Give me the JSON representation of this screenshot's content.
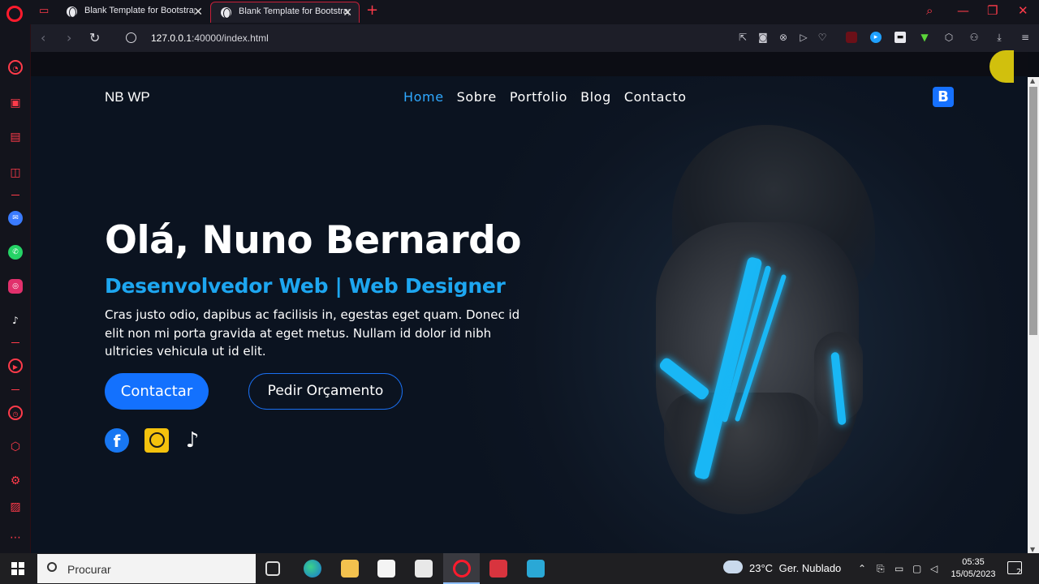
{
  "browser": {
    "tabs": [
      {
        "title": "Blank Template for Bootstrap",
        "active": false
      },
      {
        "title": "Blank Template for Bootstrap",
        "active": true
      }
    ],
    "url_host": "127.0.0.1",
    "url_rest": ":40000/index.html",
    "accent_color": "#ff1b2d"
  },
  "site": {
    "brand": "NB WP",
    "nav": [
      {
        "label": "Home",
        "current": true
      },
      {
        "label": "Sobre"
      },
      {
        "label": "Portfolio"
      },
      {
        "label": "Blog"
      },
      {
        "label": "Contacto"
      }
    ],
    "badge": "B",
    "hero": {
      "title": "Olá, Nuno Bernardo",
      "subtitle": "Desenvolvedor Web | Web Designer",
      "description": "Cras justo odio, dapibus ac facilisis in, egestas eget quam. Donec id elit non mi porta gravida at eget metus. Nullam id dolor id nibh ultricies vehicula ut id elit.",
      "primary_button": "Contactar",
      "secondary_button": "Pedir Orçamento",
      "social": [
        "facebook-icon",
        "whatsapp-icon",
        "tiktok-icon"
      ]
    },
    "colors": {
      "accent": "#1da6f0",
      "button": "#1371fe",
      "background": "#0e1624"
    }
  },
  "taskbar": {
    "search_placeholder": "Procurar",
    "weather_temp": "23°C",
    "weather_desc": "Ger. Nublado",
    "time": "05:35",
    "date": "15/05/2023",
    "notifications": "2"
  }
}
